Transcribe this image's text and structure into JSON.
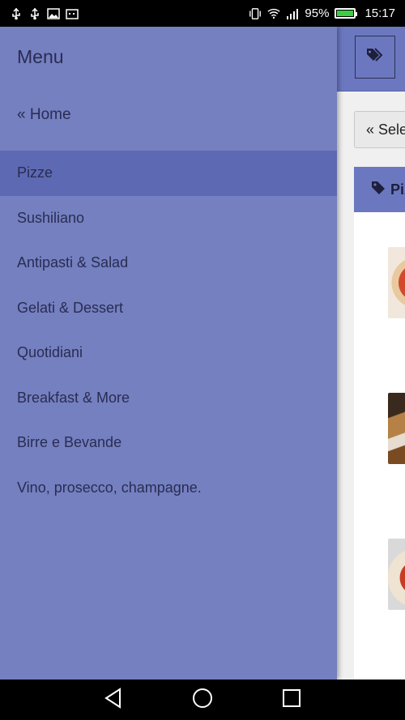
{
  "status_bar": {
    "battery": "95%",
    "time": "15:17",
    "icons": [
      "usb-icon",
      "usb-icon",
      "image-icon",
      "calendar-icon",
      "vibrate-icon",
      "wifi-icon",
      "signal-icon",
      "battery-icon"
    ]
  },
  "drawer": {
    "title": "Menu",
    "home_link": "« Home",
    "items": [
      {
        "label": "Pizze",
        "active": true
      },
      {
        "label": "Sushiliano"
      },
      {
        "label": "Antipasti & Salad"
      },
      {
        "label": "Gelati & Dessert"
      },
      {
        "label": "Quotidiani"
      },
      {
        "label": "Breakfast & More"
      },
      {
        "label": "Birre e Bevande"
      },
      {
        "label": "Vino, prosecco, champagne."
      }
    ]
  },
  "main": {
    "select_button": "« Sele",
    "category_header": "Piz"
  },
  "colors": {
    "drawer_bg": "#7480c0",
    "drawer_active": "#5d69b2",
    "header_bg": "#6b78c0",
    "text_dark": "#2a2c52"
  },
  "navbar": {
    "icons": [
      "back-icon",
      "home-icon",
      "recents-icon"
    ]
  }
}
